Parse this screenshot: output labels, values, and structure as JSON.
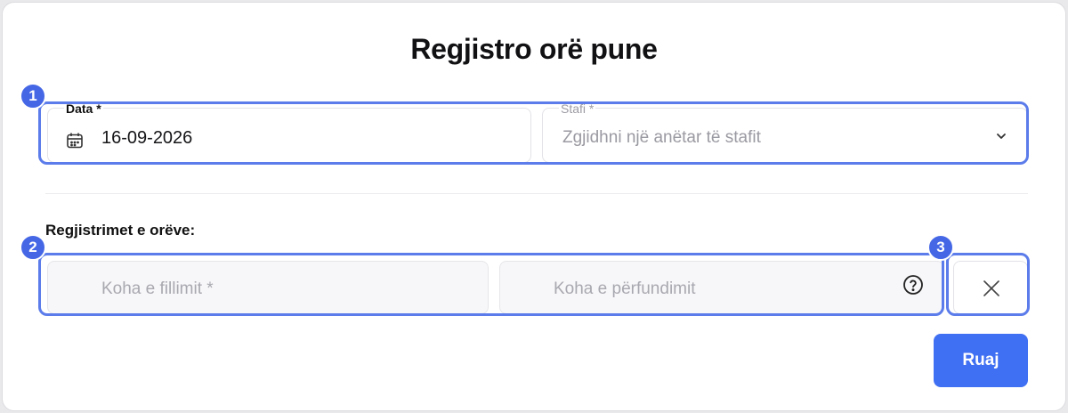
{
  "dialog": {
    "title": "Regjistro orë pune"
  },
  "date_field": {
    "label": "Data *",
    "value": "16-09-2026",
    "icon": "calendar-icon"
  },
  "staff_field": {
    "label": "Stafi *",
    "placeholder": "Zgjidhni një anëtar të stafit",
    "icon": "chevron-down-icon"
  },
  "entries": {
    "section_label": "Regjistrimet e orëve:",
    "start_placeholder": "Koha e fillimit *",
    "end_placeholder": "Koha e përfundimit",
    "help_icon": "question-circle-icon",
    "remove_icon": "close-icon"
  },
  "actions": {
    "save_label": "Ruaj"
  },
  "annotations": {
    "badge_1": "1",
    "badge_2": "2",
    "badge_3": "3"
  },
  "colors": {
    "primary": "#3f6ff2",
    "highlight": "#5b7cea"
  }
}
